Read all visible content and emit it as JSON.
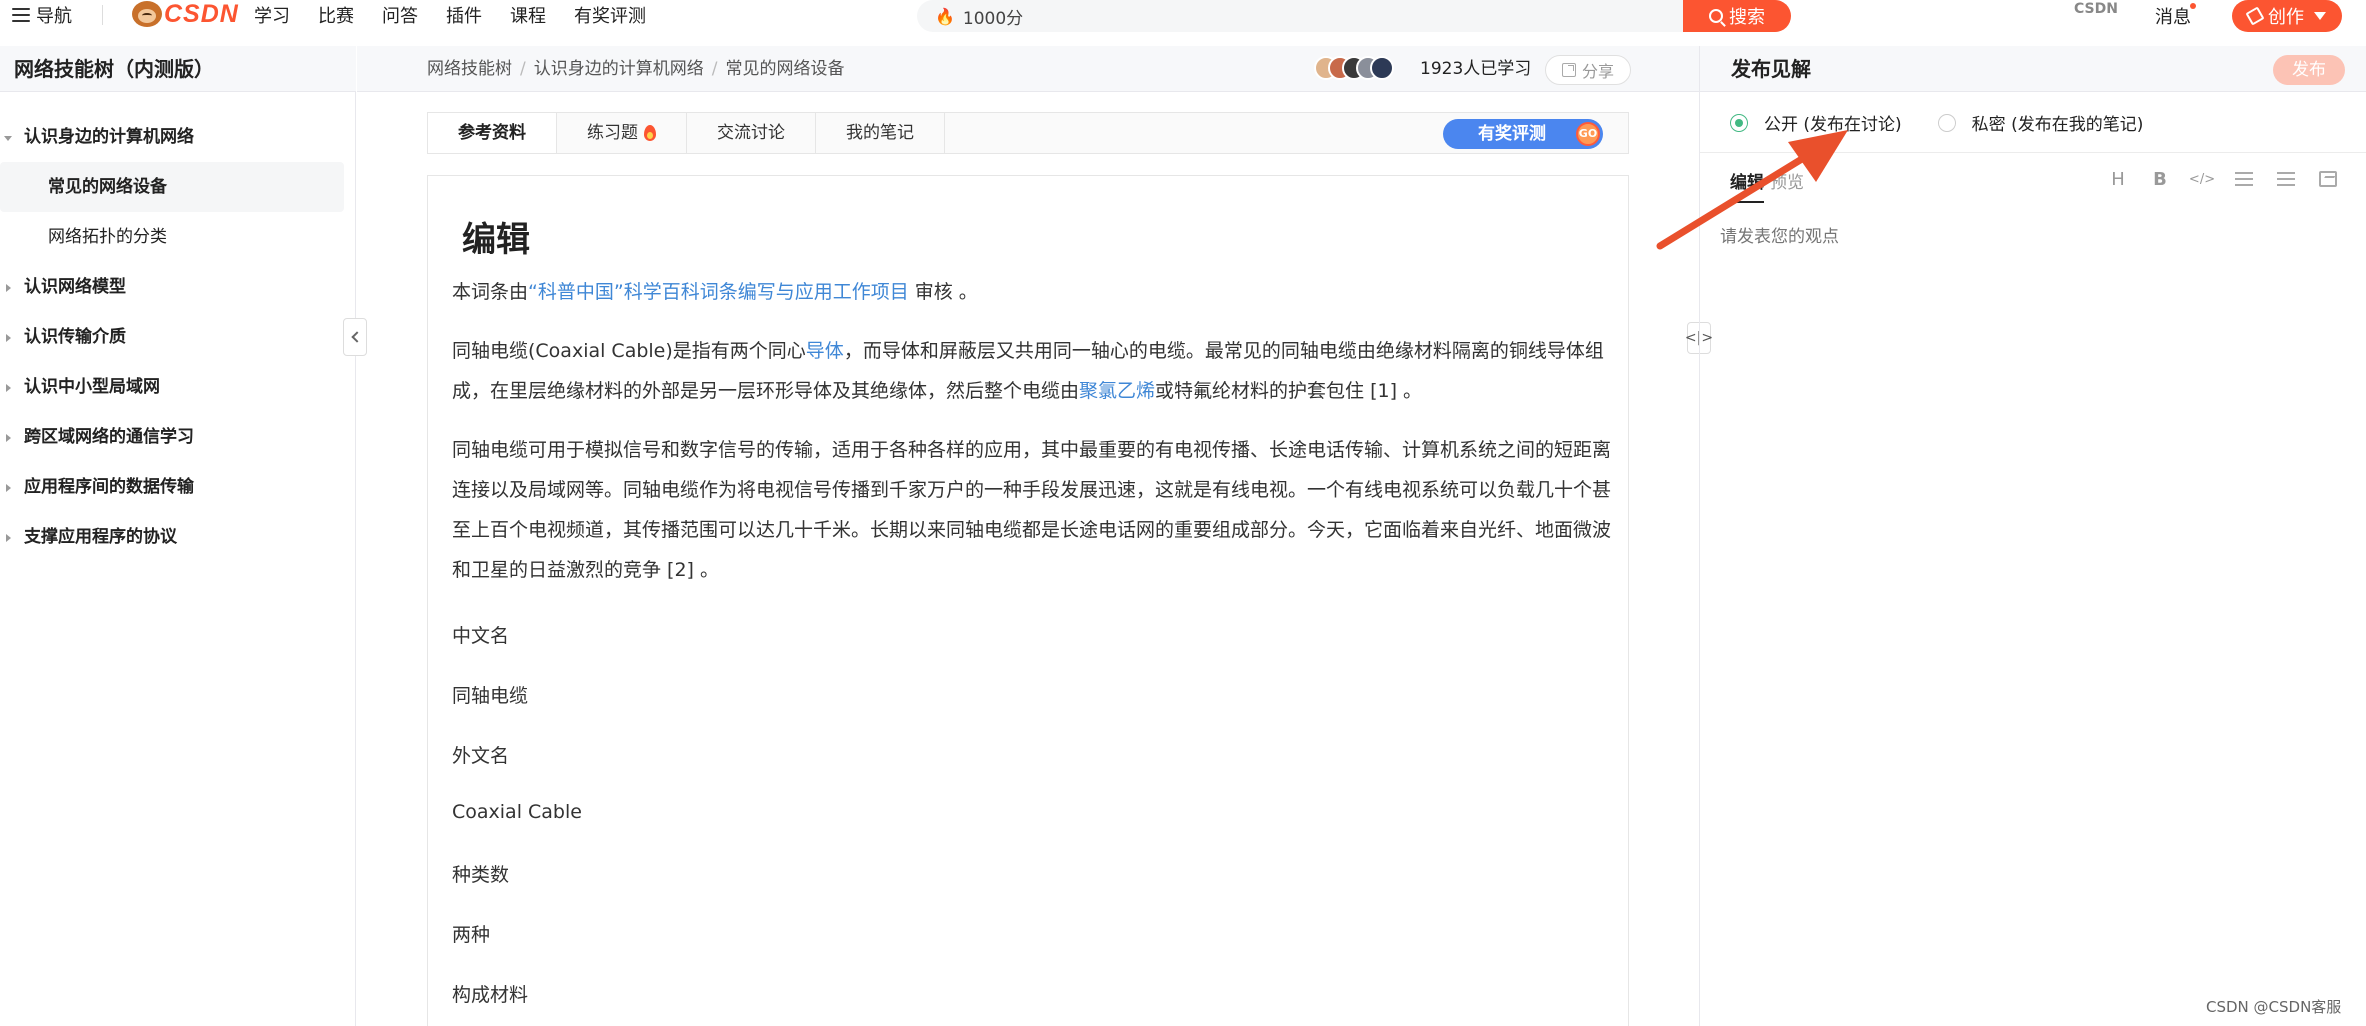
{
  "topbar": {
    "nav_label": "导航",
    "logo_text": "CSDN",
    "menu": [
      "学习",
      "比赛",
      "问答",
      "插件",
      "课程",
      "有奖评测"
    ],
    "search_placeholder": "1000分",
    "search_button": "搜索",
    "csdn_mini": "CSDN",
    "messages_label": "消息",
    "create_button": "创作"
  },
  "sidebar": {
    "title": "网络技能树（内测版）",
    "items": [
      {
        "label": "认识身边的计算机网络",
        "open": true
      },
      {
        "label": "常见的网络设备",
        "sub": true,
        "active": true
      },
      {
        "label": "网络拓扑的分类",
        "sub": true
      },
      {
        "label": "认识网络模型"
      },
      {
        "label": "认识传输介质"
      },
      {
        "label": "认识中小型局域网"
      },
      {
        "label": "跨区域网络的通信学习"
      },
      {
        "label": "应用程序间的数据传输"
      },
      {
        "label": "支撑应用程序的协议"
      }
    ]
  },
  "breadcrumb": [
    "网络技能树",
    "认识身边的计算机网络",
    "常见的网络设备"
  ],
  "learned_text": "1923人已学习",
  "share_label": "分享",
  "tabs": [
    "参考资料",
    "练习题",
    "交流讨论",
    "我的笔记"
  ],
  "eval_button": "有奖评测",
  "go_badge": "GO",
  "article": {
    "heading": "编辑",
    "review_prefix": "本词条由",
    "review_link": "“科普中国”科学百科词条编写与应用工作项目",
    "review_suffix": " 审核 。",
    "p1_a": "同轴电缆(Coaxial Cable)是指有两个同心",
    "p1_link1": "导体",
    "p1_b": "，而导体和屏蔽层又共用同一轴心的电缆。最常见的同轴电缆由绝缘材料隔离的铜线导体组成，在里层绝缘材料的外部是另一层环形导体及其绝缘体，然后整个电缆由",
    "p1_link2": "聚氯乙烯",
    "p1_c": "或特氟纶材料的护套包住 [1]  。",
    "p2": "同轴电缆可用于模拟信号和数字信号的传输，适用于各种各样的应用，其中最重要的有电视传播、长途电话传输、计算机系统之间的短距离连接以及局域网等。同轴电缆作为将电视信号传播到千家万户的一种手段发展迅速，这就是有线电视。一个有线电视系统可以负载几十个甚至上百个电视频道，其传播范围可以达几十千米。长期以来同轴电缆都是长途电话网的重要组成部分。今天，它面临着来自光纤、地面微波和卫星的日益激烈的竞争 [2]  。",
    "fields": [
      "中文名",
      "同轴电缆",
      "外文名",
      "Coaxial Cable",
      "种类数",
      "两种",
      "构成材料"
    ]
  },
  "rpanel": {
    "title": "发布见解",
    "publish_button": "发布",
    "radio_public": "公开 (发布在讨论)",
    "radio_private": "私密 (发布在我的笔记)",
    "tab_edit": "编辑",
    "tab_preview": "预览",
    "editor_placeholder": "请发表您的观点",
    "tool_heading": "H",
    "tool_bold": "B",
    "tool_code": "</>"
  },
  "watermark": "CSDN @CSDN客服",
  "colors": {
    "brand": "#fc5531",
    "link": "#3f87d6",
    "radio_on": "#42b983",
    "eval": "#4b86ef",
    "annotation_arrow": "#e9502c"
  },
  "icons": [
    "hamburger-icon",
    "flame-icon",
    "search-icon",
    "pencil-icon",
    "share-icon",
    "fire-icon",
    "chevron-left-icon",
    "resize-icon",
    "list-icon",
    "ordered-list-icon",
    "image-icon",
    "annotation-arrow"
  ]
}
